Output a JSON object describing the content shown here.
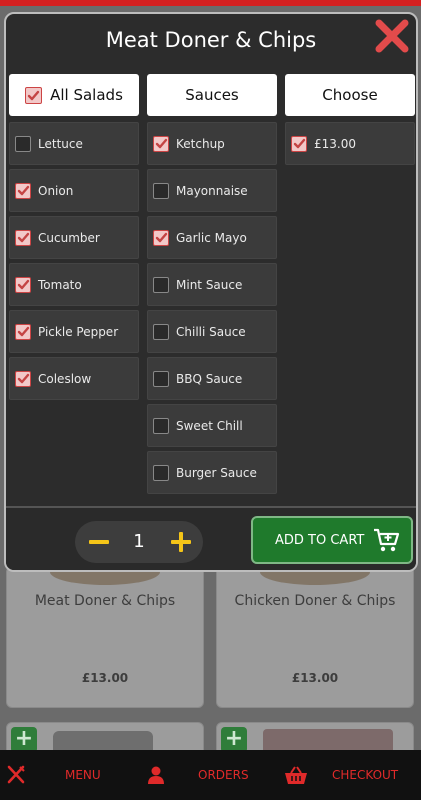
{
  "modal": {
    "title": "Meat Doner & Chips",
    "close_icon": "close-icon"
  },
  "columns": {
    "salads": {
      "header": "All Salads",
      "header_checked": true,
      "items": [
        {
          "label": "Lettuce",
          "checked": false
        },
        {
          "label": "Onion",
          "checked": true
        },
        {
          "label": "Cucumber",
          "checked": true
        },
        {
          "label": "Tomato",
          "checked": true
        },
        {
          "label": "Pickle Pepper",
          "checked": true
        },
        {
          "label": "Coleslow",
          "checked": true
        }
      ]
    },
    "sauces": {
      "header": "Sauces",
      "items": [
        {
          "label": "Ketchup",
          "checked": true
        },
        {
          "label": "Mayonnaise",
          "checked": false
        },
        {
          "label": "Garlic Mayo",
          "checked": true
        },
        {
          "label": "Mint Sauce",
          "checked": false
        },
        {
          "label": "Chilli Sauce",
          "checked": false
        },
        {
          "label": "BBQ Sauce",
          "checked": false
        },
        {
          "label": "Sweet Chill",
          "checked": false
        },
        {
          "label": "Burger Sauce",
          "checked": false
        }
      ]
    },
    "choose": {
      "header": "Choose",
      "items": [
        {
          "label": "£13.00",
          "checked": true
        }
      ]
    }
  },
  "footer": {
    "quantity": "1",
    "add_to_cart": "ADD TO CART"
  },
  "background": {
    "cards": [
      {
        "name": "Meat Doner & Chips",
        "price": "£13.00"
      },
      {
        "name": "Chicken Doner & Chips",
        "price": "£13.00"
      }
    ]
  },
  "bottom_nav": {
    "menu": "MENU",
    "orders": "ORDERS",
    "checkout": "CHECKOUT"
  },
  "colors": {
    "accent_red": "#e02a2a",
    "checkbox_red": "#c44444",
    "cart_green": "#1f7a2c",
    "stepper_yellow": "#f5c518"
  }
}
